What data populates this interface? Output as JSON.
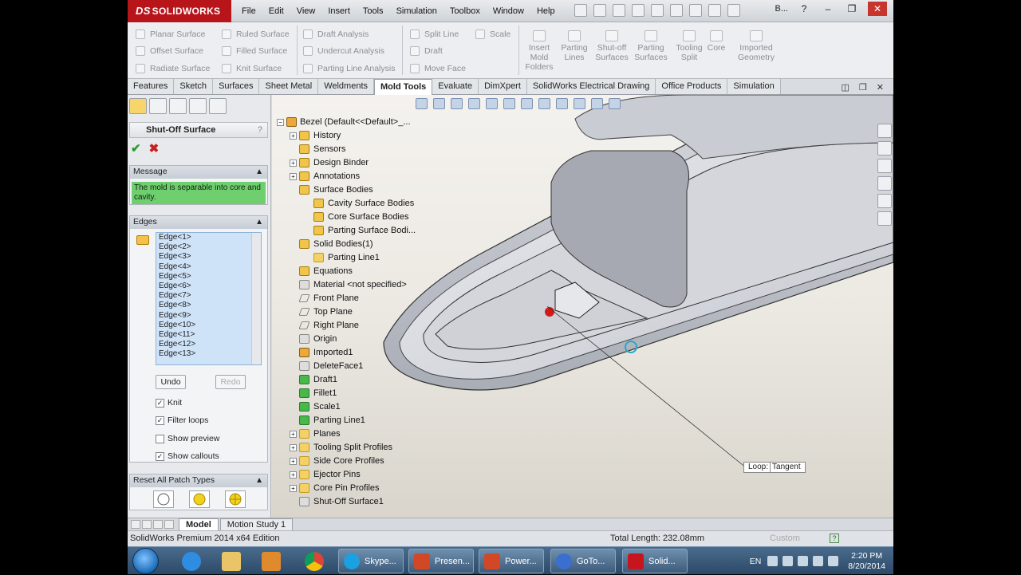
{
  "window": {
    "brand": "SOLIDWORKS",
    "user_abbrev": "B..."
  },
  "menu": [
    "File",
    "Edit",
    "View",
    "Insert",
    "Tools",
    "Simulation",
    "Toolbox",
    "Window",
    "Help"
  ],
  "ribbon": {
    "col1": [
      "Planar Surface",
      "Offset Surface",
      "Radiate Surface"
    ],
    "col2": [
      "Ruled Surface",
      "Filled Surface",
      "Knit Surface"
    ],
    "col3": [
      "Draft Analysis",
      "Undercut Analysis",
      "Parting Line Analysis"
    ],
    "col4": [
      "Split Line",
      "Draft",
      "Move Face"
    ],
    "col5": [
      "Scale"
    ],
    "big": [
      [
        "Insert",
        "Mold",
        "Folders"
      ],
      [
        "Parting",
        "Lines"
      ],
      [
        "Shut-off",
        "Surfaces"
      ],
      [
        "Parting",
        "Surfaces"
      ],
      [
        "Tooling",
        "Split"
      ],
      [
        "Core"
      ],
      [
        "Imported",
        "Geometry"
      ]
    ]
  },
  "tabs": [
    "Features",
    "Sketch",
    "Surfaces",
    "Sheet Metal",
    "Weldments",
    "Mold Tools",
    "Evaluate",
    "DimXpert",
    "SolidWorks Electrical Drawing",
    "Office Products",
    "Simulation"
  ],
  "active_tab": "Mold Tools",
  "pm": {
    "title": "Shut-Off Surface",
    "help": "?",
    "message_head": "Message",
    "message": "The mold is separable into core and cavity.",
    "edges_head": "Edges",
    "edges": [
      "Edge<1>",
      "Edge<2>",
      "Edge<3>",
      "Edge<4>",
      "Edge<5>",
      "Edge<6>",
      "Edge<7>",
      "Edge<8>",
      "Edge<9>",
      "Edge<10>",
      "Edge<11>",
      "Edge<12>",
      "Edge<13>"
    ],
    "undo": "Undo",
    "redo": "Redo",
    "knit": "Knit",
    "filter": "Filter loops",
    "preview": "Show preview",
    "callouts": "Show callouts",
    "reset_head": "Reset All Patch Types"
  },
  "tree": {
    "root": "Bezel  (Default<<Default>_...",
    "items": [
      {
        "label": "History",
        "icon": "feat",
        "plus": true,
        "indent": 0
      },
      {
        "label": "Sensors",
        "icon": "feat",
        "plus": false,
        "indent": 0
      },
      {
        "label": "Design Binder",
        "icon": "feat",
        "plus": true,
        "indent": 0
      },
      {
        "label": "Annotations",
        "icon": "feat",
        "plus": true,
        "indent": 0
      },
      {
        "label": "Surface Bodies",
        "icon": "feat",
        "plus": false,
        "indent": 0
      },
      {
        "label": "Cavity Surface Bodies",
        "icon": "feat",
        "plus": false,
        "indent": 1
      },
      {
        "label": "Core Surface Bodies",
        "icon": "feat",
        "plus": false,
        "indent": 1
      },
      {
        "label": "Parting Surface Bodi...",
        "icon": "feat",
        "plus": false,
        "indent": 1
      },
      {
        "label": "Solid Bodies(1)",
        "icon": "feat",
        "plus": false,
        "indent": 0
      },
      {
        "label": "Parting Line1",
        "icon": "folder",
        "plus": false,
        "indent": 1
      },
      {
        "label": "Equations",
        "icon": "feat",
        "plus": false,
        "indent": 0
      },
      {
        "label": "Material <not specified>",
        "icon": "gray",
        "plus": false,
        "indent": 0
      },
      {
        "label": "Front Plane",
        "icon": "plane",
        "plus": false,
        "indent": 0
      },
      {
        "label": "Top Plane",
        "icon": "plane",
        "plus": false,
        "indent": 0
      },
      {
        "label": "Right Plane",
        "icon": "plane",
        "plus": false,
        "indent": 0
      },
      {
        "label": "Origin",
        "icon": "gray",
        "plus": false,
        "indent": 0
      },
      {
        "label": "Imported1",
        "icon": "part",
        "plus": false,
        "indent": 0
      },
      {
        "label": "DeleteFace1",
        "icon": "gray",
        "plus": false,
        "indent": 0
      },
      {
        "label": "Draft1",
        "icon": "green",
        "plus": false,
        "indent": 0
      },
      {
        "label": "Fillet1",
        "icon": "green",
        "plus": false,
        "indent": 0
      },
      {
        "label": "Scale1",
        "icon": "green",
        "plus": false,
        "indent": 0
      },
      {
        "label": "Parting Line1",
        "icon": "green",
        "plus": false,
        "indent": 0
      },
      {
        "label": "Planes",
        "icon": "folder",
        "plus": true,
        "indent": 0
      },
      {
        "label": "Tooling Split Profiles",
        "icon": "folder",
        "plus": true,
        "indent": 0
      },
      {
        "label": "Side Core Profiles",
        "icon": "folder",
        "plus": true,
        "indent": 0
      },
      {
        "label": "Ejector Pins",
        "icon": "folder",
        "plus": true,
        "indent": 0
      },
      {
        "label": "Core Pin Profiles",
        "icon": "folder",
        "plus": true,
        "indent": 0
      },
      {
        "label": "Shut-Off Surface1",
        "icon": "gray",
        "plus": false,
        "indent": 0
      }
    ]
  },
  "callout": {
    "a": "Loop:",
    "b": "Tangent"
  },
  "bottom_tabs": [
    "Model",
    "Motion Study 1"
  ],
  "status": {
    "left": "SolidWorks Premium 2014 x64 Edition",
    "mid": "Total Length: 232.08mm",
    "custom": "Custom",
    "help": "?"
  },
  "taskbar": {
    "items": [
      "Skype...",
      "Presen...",
      "Power...",
      "GoTo...",
      "Solid..."
    ],
    "lang": "EN",
    "time": "2:20 PM",
    "date": "8/20/2014"
  },
  "colors": {
    "brand": "#b8151b",
    "message_bg": "#6fcf6f",
    "edge_list": "#cfe3f8"
  }
}
